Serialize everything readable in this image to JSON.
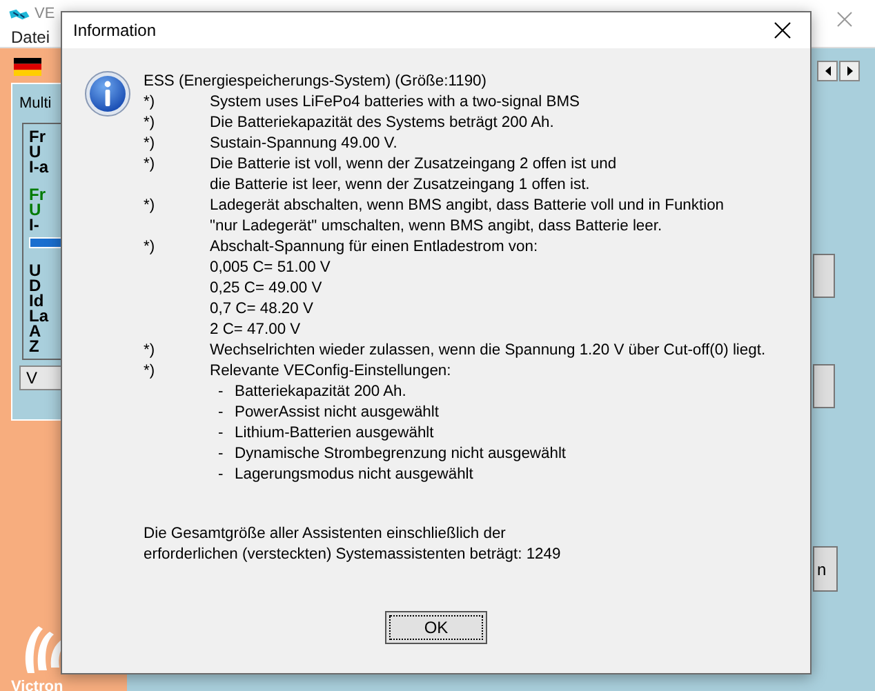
{
  "app": {
    "title": "VE",
    "menu": [
      "Datei"
    ],
    "tab_label": "Multi",
    "progress": {
      "level": 1
    },
    "panel_lines": [
      {
        "text": "Fr",
        "color": "#000000"
      },
      {
        "text": "U",
        "color": "#000000"
      },
      {
        "text": "I-a",
        "color": "#000000"
      },
      {
        "text": "Fr",
        "color": "#007a00"
      },
      {
        "text": "U",
        "color": "#007a00"
      },
      {
        "text": "I-",
        "color": "#000000"
      },
      {
        "text": "U",
        "color": "#000000"
      },
      {
        "text": "D",
        "color": "#000000"
      },
      {
        "text": "Id",
        "color": "#000000"
      },
      {
        "text": "La",
        "color": "#000000"
      },
      {
        "text": "A",
        "color": "#000000"
      },
      {
        "text": "Z",
        "color": "#000000"
      }
    ],
    "panel_button": "V",
    "logo_text": "Victron",
    "right_button": "n"
  },
  "dialog": {
    "title": "Information",
    "heading": "ESS (Energiespeicherungs-System) (Größe:1190)",
    "items": [
      {
        "kind": "note",
        "marker": "*)",
        "text": "System uses LiFePo4 batteries with a two-signal BMS"
      },
      {
        "kind": "note",
        "marker": "*)",
        "text": "Die Batteriekapazität des Systems beträgt 200 Ah."
      },
      {
        "kind": "note",
        "marker": "*)",
        "text": "Sustain-Spannung 49.00 V."
      },
      {
        "kind": "note",
        "marker": "*)",
        "text": "Die Batterie ist voll, wenn der Zusatzeingang 2 offen ist und"
      },
      {
        "kind": "continuation",
        "text": "die Batterie ist leer, wenn der Zusatzeingang 1 offen ist."
      },
      {
        "kind": "note",
        "marker": "*)",
        "text": "Ladegerät abschalten, wenn BMS angibt, dass Batterie voll und in Funktion"
      },
      {
        "kind": "continuation",
        "text": "\"nur Ladegerät\" umschalten, wenn BMS angibt, dass Batterie leer."
      },
      {
        "kind": "note",
        "marker": "*)",
        "text": "Abschalt-Spannung für einen Entladestrom von:"
      },
      {
        "kind": "continuation",
        "text": "0,005 C= 51.00 V"
      },
      {
        "kind": "continuation",
        "text": "0,25 C= 49.00 V"
      },
      {
        "kind": "continuation",
        "text": "0,7 C= 48.20 V"
      },
      {
        "kind": "continuation",
        "text": "2 C= 47.00 V"
      },
      {
        "kind": "note",
        "marker": "*)",
        "text": "Wechselrichten wieder zulassen, wenn die Spannung 1.20 V über Cut-off(0) liegt."
      },
      {
        "kind": "note",
        "marker": "*)",
        "text": "Relevante VEConfig-Einstellungen:"
      },
      {
        "kind": "setting",
        "marker": "-",
        "text": "Batteriekapazität 200 Ah."
      },
      {
        "kind": "setting",
        "marker": "-",
        "text": "PowerAssist nicht ausgewählt"
      },
      {
        "kind": "setting",
        "marker": "-",
        "text": "Lithium-Batterien ausgewählt"
      },
      {
        "kind": "setting",
        "marker": "-",
        "text": "Dynamische Strombegrenzung nicht ausgewählt"
      },
      {
        "kind": "setting",
        "marker": "-",
        "text": "Lagerungsmodus nicht ausgewählt"
      }
    ],
    "summary": [
      "Die Gesamtgröße aller Assistenten einschließlich der",
      "erforderlichen (versteckten) Systemassistenten beträgt: 1249"
    ],
    "ok_button": "OK"
  }
}
